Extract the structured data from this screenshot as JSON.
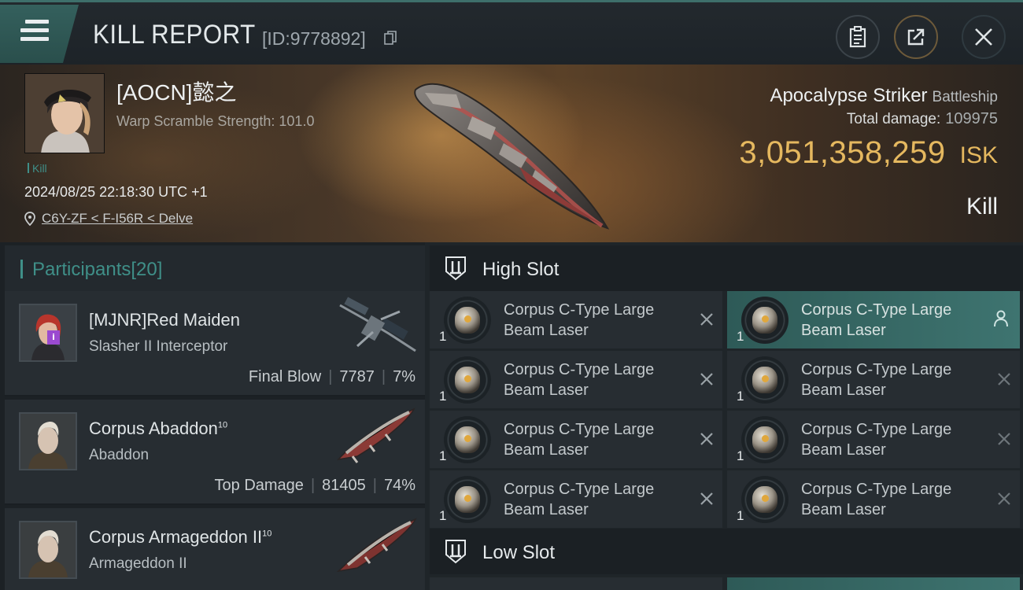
{
  "header": {
    "title": "KILL REPORT",
    "report_id": "[ID:9778892]"
  },
  "victim": {
    "name": "[AOCN]懿之",
    "warp_scramble": "Warp Scramble Strength: 101.0",
    "tag": "Kill",
    "timestamp": "2024/08/25 22:18:30 UTC +1",
    "location": "C6Y-ZF < F-I56R < Delve",
    "ship_name": "Apocalypse Striker",
    "ship_class": "Battleship",
    "total_damage_label": "Total damage:",
    "total_damage": "109975",
    "isk_value": "3,051,358,259",
    "isk_unit": "ISK",
    "result": "Kill"
  },
  "participants": {
    "label": "Participants",
    "count": "[20]",
    "items": [
      {
        "name": "[MJNR]Red Maiden",
        "level": "",
        "ship": "Slasher II Interceptor",
        "role": "Final Blow",
        "damage": "7787",
        "percent": "7%"
      },
      {
        "name": "Corpus Abaddon",
        "level": "10",
        "ship": "Abaddon",
        "role": "Top Damage",
        "damage": "81405",
        "percent": "74%"
      },
      {
        "name": "Corpus Armageddon II",
        "level": "10",
        "ship": "Armageddon II",
        "role": "",
        "damage": "",
        "percent": ""
      }
    ]
  },
  "slots": {
    "high_label": "High Slot",
    "low_label": "Low Slot",
    "high_items": [
      {
        "name": "Corpus C-Type Large Beam Laser",
        "qty": "1",
        "status": "destroyed"
      },
      {
        "name": "Corpus C-Type Large Beam Laser",
        "qty": "1",
        "status": "dropped"
      },
      {
        "name": "Corpus C-Type Large Beam Laser",
        "qty": "1",
        "status": "destroyed"
      },
      {
        "name": "Corpus C-Type Large Beam Laser",
        "qty": "1",
        "status": "destroyed"
      },
      {
        "name": "Corpus C-Type Large Beam Laser",
        "qty": "1",
        "status": "destroyed"
      },
      {
        "name": "Corpus C-Type Large Beam Laser",
        "qty": "1",
        "status": "destroyed"
      },
      {
        "name": "Corpus C-Type Large Beam Laser",
        "qty": "1",
        "status": "destroyed"
      },
      {
        "name": "Corpus C-Type Large Beam Laser",
        "qty": "1",
        "status": "destroyed"
      }
    ]
  },
  "colors": {
    "accent_teal": "#3f8f88",
    "isk_gold": "#e5b85f",
    "highlight_slot": "#3e7470"
  },
  "icons": [
    "menu-icon",
    "copy-icon",
    "clipboard-icon",
    "share-icon",
    "close-icon",
    "pin-icon",
    "slot-icon",
    "person-icon",
    "x-icon"
  ]
}
